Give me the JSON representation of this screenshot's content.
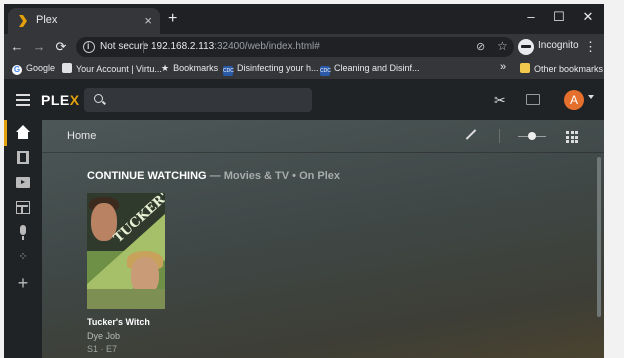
{
  "browser": {
    "tab": {
      "title": "Plex",
      "close": "×"
    },
    "new_tab": "+",
    "window_controls": {
      "minimize": "–",
      "maximize": "☐",
      "close": "✕"
    },
    "nav": {
      "back": "←",
      "forward": "→",
      "reload": "⟳"
    },
    "omnibox": {
      "security": "Not secure",
      "host": "192.168.2.113",
      "rest": ":32400/web/index.html#"
    },
    "profile_label": "Incognito",
    "menu": "⋮",
    "bookmarks": [
      {
        "label": "Google",
        "icon": "google-icon"
      },
      {
        "label": "Your Account | Virtu...",
        "icon": "document-icon"
      },
      {
        "label": "Bookmarks",
        "icon": "star-icon"
      },
      {
        "label": "Disinfecting your h...",
        "icon": "cdc-icon"
      },
      {
        "label": "Cleaning and Disinf...",
        "icon": "cdc-icon"
      }
    ],
    "overflow": "»",
    "other_bookmarks": "Other bookmarks"
  },
  "plex": {
    "logo_main": "PLE",
    "logo_accent": "X",
    "accent_color": "#e5a00d",
    "avatar_letter": "A",
    "avatar_color": "#e5702e",
    "sidebar": [
      "home",
      "movies",
      "tv-shows",
      "library",
      "voice",
      "hub",
      "add"
    ],
    "page_title": "Home",
    "section": {
      "title": "CONTINUE WATCHING",
      "subtitle": "— Movies & TV • On Plex"
    },
    "items": [
      {
        "poster_title": "TUCKER'S WITCH",
        "title": "Tucker's Witch",
        "episode": "Dye Job",
        "episode_number": "S1 · E7"
      }
    ]
  }
}
